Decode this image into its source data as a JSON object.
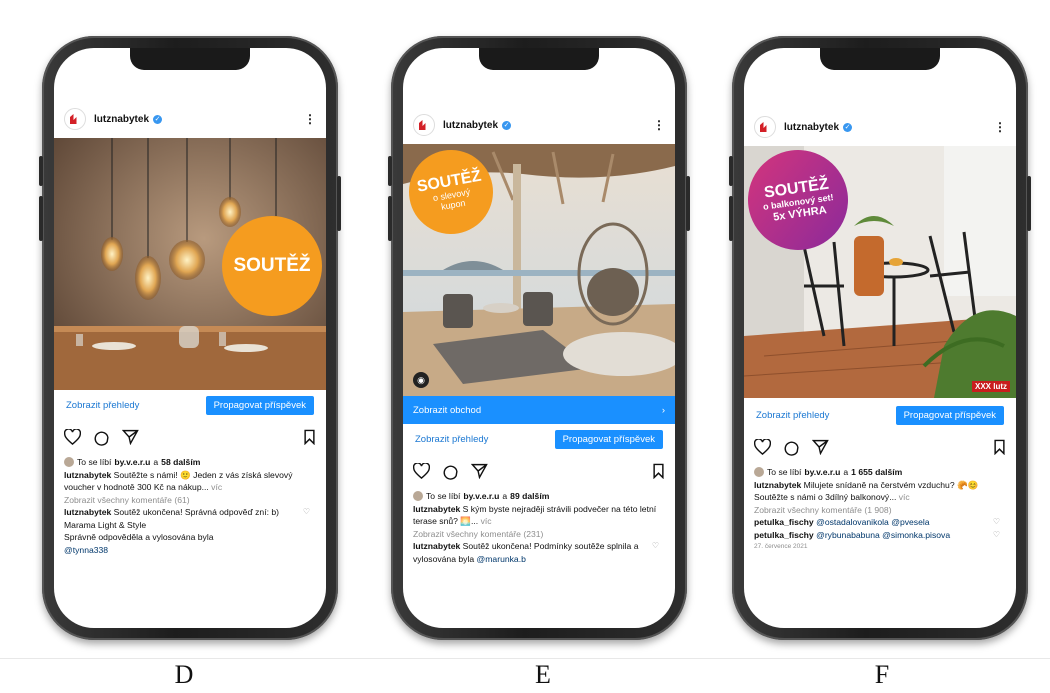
{
  "posts": [
    {
      "account": "lutznabytek",
      "badge": "SOUTĚŽ",
      "badge_color": "#f59c1f",
      "shop_label": null,
      "insights_label": "Zobrazit přehledy",
      "promote_label": "Propagovat příspěvek",
      "likes_prefix": "To se líbí",
      "likes_user": "by.v.e.r.u",
      "likes_mid": "a",
      "likes_count": "58 dalším",
      "caption_user": "lutznabytek",
      "caption_text": "Soutěžte s námi! 🙂 Jeden z vás získá slevový voucher v hodnotě 300 Kč na nákup...",
      "more": "víc",
      "view_comments": "Zobrazit všechny komentáře (61)",
      "comment_user": "lutznabytek",
      "comment_text": "Soutěž ukončena! Správná odpověď zní: b) Marama Light & Style",
      "comment_text2": "Správně odpověděla a vylosována byla",
      "comment_tag": "@tynna338",
      "label": "D"
    },
    {
      "account": "lutznabytek",
      "badge": "SOUTĚŽ",
      "badge_sub1": "o slevový",
      "badge_sub2": "kupon",
      "badge_color": "#f59c1f",
      "shop_label": "Zobrazit obchod",
      "insights_label": "Zobrazit přehledy",
      "promote_label": "Propagovat příspěvek",
      "likes_prefix": "To se líbí",
      "likes_user": "by.v.e.r.u",
      "likes_mid": "a",
      "likes_count": "89 dalším",
      "caption_user": "lutznabytek",
      "caption_text": "S kým byste nejraději strávili podvečer na této letní terase snů? 🌅...",
      "more": "víc",
      "view_comments": "Zobrazit všechny komentáře (231)",
      "comment_user": "lutznabytek",
      "comment_text": "Soutěž ukončena! Podmínky soutěže splnila a vylosována byla",
      "comment_tag": "@marunka.b",
      "label": "E"
    },
    {
      "account": "lutznabytek",
      "badge": "SOUTĚŽ",
      "badge_sub1": "o balkonový set!",
      "badge_sub2": "5x VÝHRA",
      "badge_color": "#b8267e",
      "watermark": "XXX lutz",
      "insights_label": "Zobrazit přehledy",
      "promote_label": "Propagovat příspěvek",
      "likes_prefix": "To se líbí",
      "likes_user": "by.v.e.r.u",
      "likes_mid": "a",
      "likes_count": "1 655 dalším",
      "caption_user": "lutznabytek",
      "caption_text": "Milujete snídaně na čerstvém vzduchu? 🥐😊 Soutěžte s námi o 3dílný balkonový...",
      "more": "víc",
      "view_comments": "Zobrazit všechny komentáře (1 908)",
      "comment1_user": "petulka_fischy",
      "comment1_tags": "@ostadalovanikola @pvesela",
      "comment2_user": "petulka_fischy",
      "comment2_tags": "@rybunababuna @simonka.pisova",
      "date": "27. července 2021",
      "label": "F"
    }
  ]
}
